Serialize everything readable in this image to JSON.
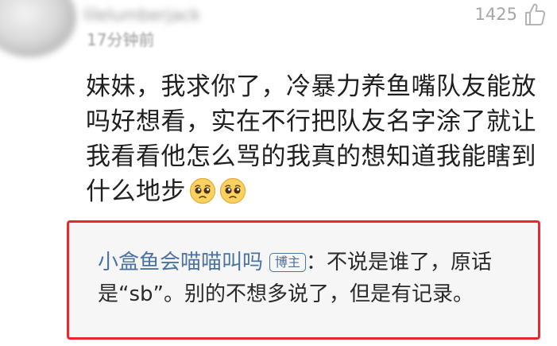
{
  "comment": {
    "username": "lilelumberjack",
    "timestamp": "17分钟前",
    "like_count": "1425",
    "text": "妹妹，我求你了，冷暴力养鱼嘴队友能放吗好想看，实在不行把队友名字涂了就让我看看他怎么骂的我真的想知道我能瞎到什么地步",
    "emojis": [
      "pleading-face-icon",
      "pleading-face-icon"
    ]
  },
  "reply": {
    "author": "小盒鱼会喵喵叫吗",
    "badge": "博主",
    "text": "：不说是谁了，原话是“sb”。别的不想多说了，但是有记录。"
  },
  "colors": {
    "highlight_border": "#e8282d",
    "author_link": "#4a72a3",
    "reply_background": "#f6f6f6",
    "muted_text": "#9a9a9a"
  }
}
